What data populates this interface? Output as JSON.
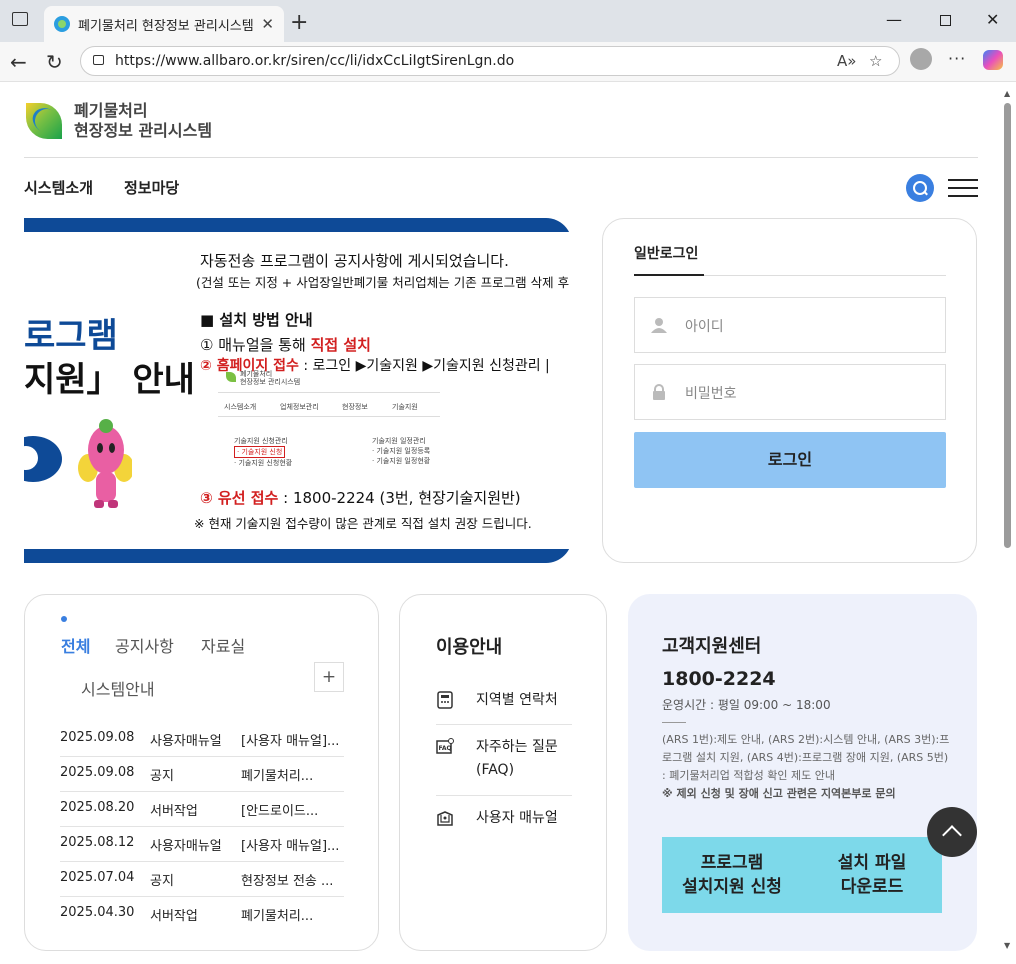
{
  "browser": {
    "tab_title": "폐기물처리 현장정보 관리시스템",
    "url": "https://www.allbaro.or.kr/siren/cc/li/idxCcLiIgtSirenLgn.do"
  },
  "header": {
    "brand_line1": "폐기물처리",
    "brand_line2": "현장정보 관리시스템",
    "menu": [
      "시스템소개",
      "정보마당"
    ]
  },
  "banner": {
    "big1": "로그램",
    "big2": "지원」 안내",
    "line1": "자동전송 프로그램이 공지사항에 게시되었습니다.",
    "line2": "(건설 또는 지정 + 사업장일반폐기물 처리업체는 기존 프로그램 삭제 후",
    "line3": "■ 설치 방법 안내",
    "line4a": "① 매뉴얼을 통해 ",
    "line4b": "직접 설치",
    "line5a": "② 홈페이지 접수",
    "line5b": " : 로그인 ▶기술지원 ▶기술지원 신청관리 |",
    "line6a": "③ 유선 접수",
    "line6b": " : 1800-2224 (3번, 현장기술지원반)",
    "line7": "※ 현재 기술지원 접수량이 많은 관계로 직접 설치 권장 드립니다.",
    "mini_brand1": "폐기물처리",
    "mini_brand2": "현장정보 관리시스템",
    "mini_menu": [
      "시스템소개",
      "업체정보관리",
      "현장정보",
      "기술지원"
    ],
    "mini_col1": [
      "기술지원 신청관리",
      "· 기술지원 신청",
      "· 기술지원 신청현황"
    ],
    "mini_col2": [
      "기술지원 일정관리",
      "· 기술지원 일정등록",
      "· 기술지원 일정현황"
    ]
  },
  "login": {
    "tab": "일반로그인",
    "id_placeholder": "아이디",
    "pw_placeholder": "비밀번호",
    "button": "로그인"
  },
  "notice": {
    "tabs": [
      "전체",
      "공지사항",
      "자료실",
      "시스템안내"
    ],
    "plus": "+",
    "rows": [
      {
        "date": "2025.09.08",
        "cat": "사용자매뉴얼",
        "title": "[사용자 매뉴얼]..."
      },
      {
        "date": "2025.09.08",
        "cat": "공지",
        "title": "폐기물처리..."
      },
      {
        "date": "2025.08.20",
        "cat": "서버작업",
        "title": "[안드로이드..."
      },
      {
        "date": "2025.08.12",
        "cat": "사용자매뉴얼",
        "title": "[사용자 매뉴얼]..."
      },
      {
        "date": "2025.07.04",
        "cat": "공지",
        "title": "현장정보 전송 ..."
      },
      {
        "date": "2025.04.30",
        "cat": "서버작업",
        "title": "폐기물처리..."
      }
    ]
  },
  "guide": {
    "title": "이용안내",
    "items": [
      {
        "label": "지역별 연락처",
        "icon": "phone-icon"
      },
      {
        "label": "자주하는 질문 (FAQ)",
        "icon": "faq-icon"
      },
      {
        "label": "사용자 매뉴얼",
        "icon": "manual-icon"
      }
    ]
  },
  "support": {
    "title": "고객지원센터",
    "phone": "1800-2224",
    "hours": "운영시간 : 평일 09:00 ~ 18:00",
    "info": "(ARS 1번):제도 안내, (ARS 2번):시스템 안내, (ARS 3번):프로그램 설치 지원, (ARS 4번):프로그램 장애 지원, (ARS 5번) : 폐기물처리업 적합성 확인 제도 안내",
    "note": "※ 제외 신청 및 장애 신고 관련은 지역본부로 문의",
    "btn1_line1": "프로그램",
    "btn1_line2": "설치지원 신청",
    "btn2_line1": "설치 파일",
    "btn2_line2": "다운로드"
  },
  "colors": {
    "accent": "#3a7fe0",
    "navy": "#0e4a97",
    "login_btn": "#8fc4f3",
    "support_btn": "#7dd9ea"
  }
}
